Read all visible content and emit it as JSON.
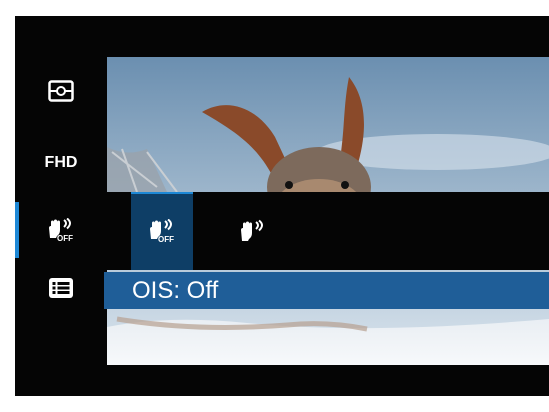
{
  "sidebar": {
    "items": [
      {
        "icon": "metering-icon"
      },
      {
        "label": "FHD"
      },
      {
        "icon": "ois-off-icon"
      },
      {
        "icon": "menu-list-icon"
      }
    ],
    "active_index": 2
  },
  "options": [
    {
      "icon": "ois-off-icon",
      "selected": true
    },
    {
      "icon": "ois-on-icon",
      "selected": false
    }
  ],
  "caption": "OIS: Off",
  "icon_text": {
    "off": "OFF"
  },
  "colors": {
    "accent": "#1d88d6",
    "caption_bg": "#1f5e98",
    "selected_bg": "#0e3e66"
  }
}
